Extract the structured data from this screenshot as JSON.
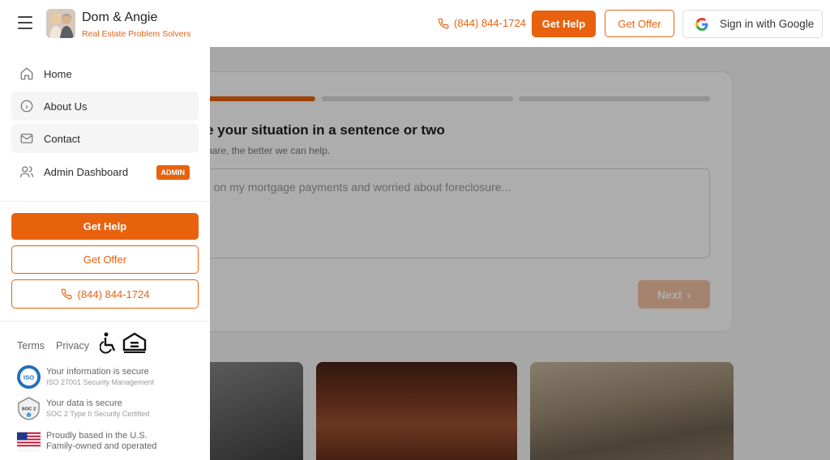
{
  "header": {
    "brand_name": "Dom & Angie",
    "brand_tagline": "Real Estate Problem Solvers",
    "phone": "(844) 844-1724",
    "get_help": "Get Help",
    "get_offer": "Get Offer",
    "google_signin": "Sign in with Google"
  },
  "drawer": {
    "nav": [
      {
        "label": "Home",
        "icon": "home-icon"
      },
      {
        "label": "About Us",
        "icon": "info-icon"
      },
      {
        "label": "Contact",
        "icon": "mail-icon"
      },
      {
        "label": "Admin Dashboard",
        "icon": "users-icon",
        "badge": "ADMIN"
      }
    ],
    "get_help": "Get Help",
    "get_offer": "Get Offer",
    "phone": "(844) 844-1724",
    "terms": "Terms",
    "privacy": "Privacy",
    "trust": [
      {
        "line1": "Your information is secure",
        "line2": "ISO 27001 Security Management",
        "icon": "iso-badge-icon"
      },
      {
        "line1": "Your data is secure",
        "line2": "SOC 2 Type II Security Certified",
        "icon": "soc2-badge-icon"
      },
      {
        "line1": "Proudly based in the U.S.",
        "line2": "Family-owned and operated",
        "icon": "us-flag-icon"
      }
    ]
  },
  "question": {
    "title": "ibe your situation in a sentence or two",
    "subtitle": "u share, the better we can help.",
    "placeholder": "d on my mortgage payments and worried about foreclosure...",
    "next": "Next",
    "progress_step": 1,
    "progress_total": 3
  },
  "colors": {
    "accent": "#e8620e",
    "next_disabled": "#f3c3a4"
  }
}
